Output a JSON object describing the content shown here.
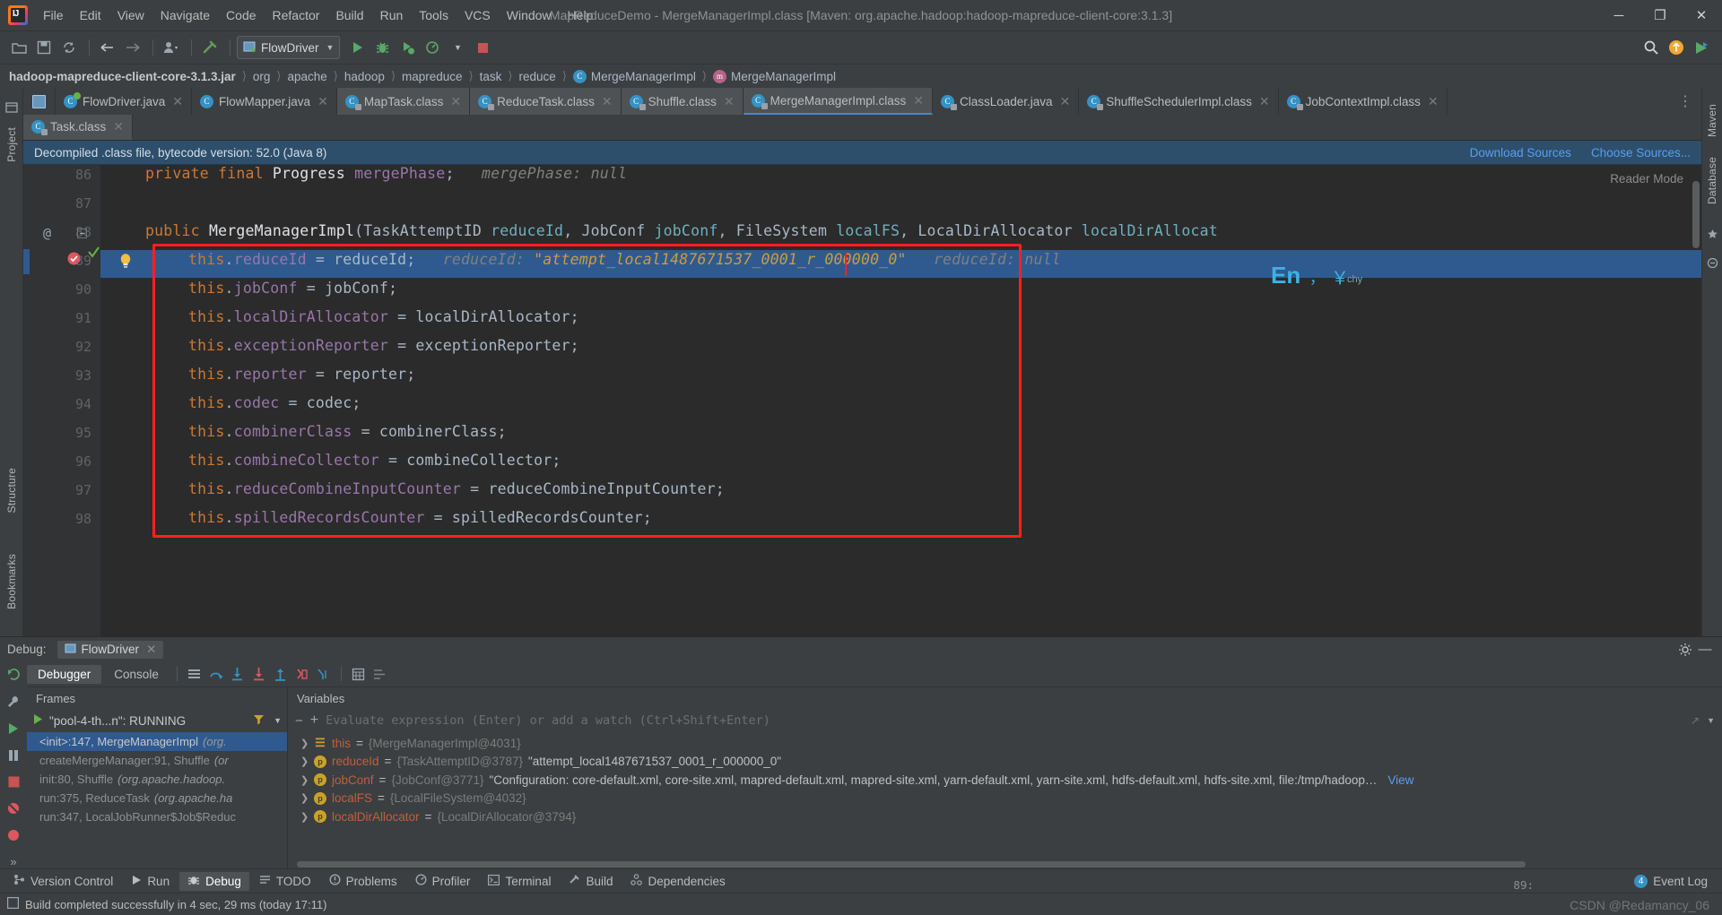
{
  "window": {
    "title": "MapReduceDemo - MergeManagerImpl.class [Maven: org.apache.hadoop:hadoop-mapreduce-client-core:3.1.3]",
    "minimize": "─",
    "maximize": "❐",
    "close": "✕"
  },
  "menu": [
    {
      "label": "File"
    },
    {
      "label": "Edit"
    },
    {
      "label": "View"
    },
    {
      "label": "Navigate"
    },
    {
      "label": "Code"
    },
    {
      "label": "Refactor"
    },
    {
      "label": "Build"
    },
    {
      "label": "Run"
    },
    {
      "label": "Tools"
    },
    {
      "label": "VCS"
    },
    {
      "label": "Window"
    },
    {
      "label": "Help"
    }
  ],
  "toolbar": {
    "run_config": "FlowDriver",
    "icons": [
      "open-folder-icon",
      "save-icon",
      "sync-icon",
      "back-arrow-icon",
      "forward-arrow-icon",
      "profile-user-icon",
      "build-hammer-icon"
    ],
    "run_icon": "run-icon",
    "debug_icon": "debug-icon",
    "run_coverage_icon": "run-with-coverage-icon",
    "profiler_icon": "profiler-icon",
    "stop_icon": "stop-icon",
    "search_icon": "search-icon",
    "update_icon": "update-available-icon",
    "ide_icon": "ide-settings-icon"
  },
  "breadcrumb": [
    {
      "label": "hadoop-mapreduce-client-core-3.1.3.jar",
      "icon": null,
      "bold": true
    },
    {
      "label": "org",
      "icon": null,
      "bold": false
    },
    {
      "label": "apache",
      "icon": null,
      "bold": false
    },
    {
      "label": "hadoop",
      "icon": null,
      "bold": false
    },
    {
      "label": "mapreduce",
      "icon": null,
      "bold": false
    },
    {
      "label": "task",
      "icon": null,
      "bold": false
    },
    {
      "label": "reduce",
      "icon": null,
      "bold": false
    },
    {
      "label": "MergeManagerImpl",
      "icon": "c",
      "bold": false
    },
    {
      "label": "MergeManagerImpl",
      "icon": "m",
      "bold": false
    }
  ],
  "editor_tabs_row1": [
    {
      "label": "FlowDriver.java",
      "icon": "java-class-icon",
      "active": false,
      "closeable": true
    },
    {
      "label": "FlowMapper.java",
      "icon": "java-class-icon",
      "active": false,
      "closeable": true
    },
    {
      "label": "MapTask.class",
      "icon": "decompiled-class-icon",
      "active": false,
      "closeable": true
    },
    {
      "label": "ReduceTask.class",
      "icon": "decompiled-class-icon",
      "active": false,
      "closeable": true
    },
    {
      "label": "Shuffle.class",
      "icon": "decompiled-class-icon",
      "active": false,
      "closeable": true
    },
    {
      "label": "MergeManagerImpl.class",
      "icon": "decompiled-class-icon",
      "active": true,
      "closeable": true
    },
    {
      "label": "ClassLoader.java",
      "icon": "decompiled-class-icon",
      "active": false,
      "closeable": true
    },
    {
      "label": "ShuffleSchedulerImpl.class",
      "icon": "decompiled-class-icon",
      "active": false,
      "closeable": true
    },
    {
      "label": "JobContextImpl.class",
      "icon": "decompiled-class-icon",
      "active": false,
      "closeable": true
    }
  ],
  "editor_tabs_row2": [
    {
      "label": "Task.class",
      "icon": "decompiled-class-icon",
      "active": true,
      "closeable": true
    }
  ],
  "banner": {
    "message": "Decompiled .class file, bytecode version: 52.0 (Java 8)",
    "download_sources": "Download Sources",
    "choose_sources": "Choose Sources..."
  },
  "editor": {
    "reader_mode": "Reader Mode",
    "ime_indicator": "En",
    "ime_punct": "，",
    "ime_yen": "￥",
    "ime_label": "chy",
    "lines": [
      {
        "num": "86",
        "marker": "",
        "segments": [
          {
            "t": "    ",
            "c": "id"
          },
          {
            "t": "private final ",
            "c": "kw"
          },
          {
            "t": "Progress ",
            "c": "white"
          },
          {
            "t": "mergePhase",
            "c": "fld"
          },
          {
            "t": ";",
            "c": "id"
          },
          {
            "t": "   mergePhase: null",
            "c": "inl"
          }
        ]
      },
      {
        "num": "87",
        "marker": "",
        "segments": []
      },
      {
        "num": "88",
        "marker": "@",
        "segments": [
          {
            "t": "    ",
            "c": "id"
          },
          {
            "t": "public ",
            "c": "kw"
          },
          {
            "t": "MergeManagerImpl",
            "c": "white"
          },
          {
            "t": "(TaskAttemptID ",
            "c": "id"
          },
          {
            "t": "reduceId",
            "c": "par"
          },
          {
            "t": ", JobConf ",
            "c": "id"
          },
          {
            "t": "jobConf",
            "c": "par"
          },
          {
            "t": ", FileSystem ",
            "c": "id"
          },
          {
            "t": "localFS",
            "c": "par"
          },
          {
            "t": ", LocalDirAllocator ",
            "c": "id"
          },
          {
            "t": "localDirAllocat",
            "c": "par"
          }
        ]
      },
      {
        "num": "89",
        "marker": "breakpoint",
        "highlight": true,
        "segments": [
          {
            "t": "        ",
            "c": "id"
          },
          {
            "t": "this",
            "c": "kw"
          },
          {
            "t": ".",
            "c": "id"
          },
          {
            "t": "reduceId",
            "c": "fld"
          },
          {
            "t": " = reduceId;",
            "c": "id"
          },
          {
            "t": "   reduceId: ",
            "c": "inl"
          },
          {
            "t": "\"attempt_local1487671537_0001_r_000000_0\"",
            "c": "inlv"
          },
          {
            "t": "   reduceId: null",
            "c": "inl"
          }
        ]
      },
      {
        "num": "90",
        "marker": "",
        "segments": [
          {
            "t": "        ",
            "c": "id"
          },
          {
            "t": "this",
            "c": "kw"
          },
          {
            "t": ".",
            "c": "id"
          },
          {
            "t": "jobConf",
            "c": "fld"
          },
          {
            "t": " = jobConf;",
            "c": "id"
          }
        ]
      },
      {
        "num": "91",
        "marker": "",
        "segments": [
          {
            "t": "        ",
            "c": "id"
          },
          {
            "t": "this",
            "c": "kw"
          },
          {
            "t": ".",
            "c": "id"
          },
          {
            "t": "localDirAllocator",
            "c": "fld"
          },
          {
            "t": " = localDirAllocator;",
            "c": "id"
          }
        ]
      },
      {
        "num": "92",
        "marker": "",
        "segments": [
          {
            "t": "        ",
            "c": "id"
          },
          {
            "t": "this",
            "c": "kw"
          },
          {
            "t": ".",
            "c": "id"
          },
          {
            "t": "exceptionReporter",
            "c": "fld"
          },
          {
            "t": " = exceptionReporter;",
            "c": "id"
          }
        ]
      },
      {
        "num": "93",
        "marker": "",
        "segments": [
          {
            "t": "        ",
            "c": "id"
          },
          {
            "t": "this",
            "c": "kw"
          },
          {
            "t": ".",
            "c": "id"
          },
          {
            "t": "reporter",
            "c": "fld"
          },
          {
            "t": " = reporter;",
            "c": "id"
          }
        ]
      },
      {
        "num": "94",
        "marker": "",
        "segments": [
          {
            "t": "        ",
            "c": "id"
          },
          {
            "t": "this",
            "c": "kw"
          },
          {
            "t": ".",
            "c": "id"
          },
          {
            "t": "codec",
            "c": "fld"
          },
          {
            "t": " = codec;",
            "c": "id"
          }
        ]
      },
      {
        "num": "95",
        "marker": "",
        "segments": [
          {
            "t": "        ",
            "c": "id"
          },
          {
            "t": "this",
            "c": "kw"
          },
          {
            "t": ".",
            "c": "id"
          },
          {
            "t": "combinerClass",
            "c": "fld"
          },
          {
            "t": " = combinerClass;",
            "c": "id"
          }
        ]
      },
      {
        "num": "96",
        "marker": "",
        "segments": [
          {
            "t": "        ",
            "c": "id"
          },
          {
            "t": "this",
            "c": "kw"
          },
          {
            "t": ".",
            "c": "id"
          },
          {
            "t": "combineCollector",
            "c": "fld"
          },
          {
            "t": " = combineCollector;",
            "c": "id"
          }
        ]
      },
      {
        "num": "97",
        "marker": "",
        "segments": [
          {
            "t": "        ",
            "c": "id"
          },
          {
            "t": "this",
            "c": "kw"
          },
          {
            "t": ".",
            "c": "id"
          },
          {
            "t": "reduceCombineInputCounter",
            "c": "fld"
          },
          {
            "t": " = reduceCombineInputCounter;",
            "c": "id"
          }
        ]
      },
      {
        "num": "98",
        "marker": "",
        "segments": [
          {
            "t": "        ",
            "c": "id"
          },
          {
            "t": "this",
            "c": "kw"
          },
          {
            "t": ".",
            "c": "id"
          },
          {
            "t": "spilledRecordsCounter",
            "c": "fld"
          },
          {
            "t": " = spilledRecordsCounter;",
            "c": "id"
          }
        ]
      }
    ]
  },
  "debug": {
    "header_label": "Debug:",
    "session_tab": "FlowDriver",
    "tabs": [
      {
        "label": "Debugger",
        "selected": true
      },
      {
        "label": "Console",
        "selected": false
      }
    ],
    "step_icons": [
      "show-execution-point-icon",
      "step-over-icon",
      "step-into-icon",
      "force-step-into-icon",
      "step-out-icon",
      "drop-frame-icon",
      "run-to-cursor-icon",
      "evaluate-expression-icon",
      "settings-icon"
    ],
    "rail_icons": [
      "rerun-icon",
      "settings-wrench-icon",
      "resume-icon",
      "pause-icon",
      "stop-red-icon",
      "mute-breakpoints-icon",
      "view-breakpoints-icon",
      "expand-icon"
    ],
    "frames_header": "Frames",
    "thread": "\"pool-4-th...n\": RUNNING",
    "frames": [
      {
        "method": "<init>:147, MergeManagerImpl",
        "pkg": "(org.",
        "selected": true
      },
      {
        "method": "createMergeManager:91, Shuffle",
        "pkg": "(or",
        "selected": false
      },
      {
        "method": "init:80, Shuffle",
        "pkg": "(org.apache.hadoop.",
        "selected": false
      },
      {
        "method": "run:375, ReduceTask",
        "pkg": "(org.apache.ha",
        "selected": false
      },
      {
        "method": "run:347, LocalJobRunner$Job$Reduc",
        "pkg": "",
        "selected": false
      }
    ],
    "variables_header": "Variables",
    "eval_placeholder": "Evaluate expression (Enter) or add a watch (Ctrl+Shift+Enter)",
    "variables": [
      {
        "name": "this",
        "icon": "object-icon",
        "value": "{MergeManagerImpl@4031}",
        "string": "",
        "view": false
      },
      {
        "name": "reduceId",
        "icon": "field-icon",
        "value": "{TaskAttemptID@3787}",
        "string": "\"attempt_local1487671537_0001_r_000000_0\"",
        "view": false
      },
      {
        "name": "jobConf",
        "icon": "field-icon",
        "value": "{JobConf@3771}",
        "string": "\"Configuration: core-default.xml, core-site.xml, mapred-default.xml, mapred-site.xml, yarn-default.xml, yarn-site.xml, hdfs-default.xml, hdfs-site.xml, file:/tmp/hadoop…",
        "view": true,
        "view_label": "View"
      },
      {
        "name": "localFS",
        "icon": "field-icon",
        "value": "{LocalFileSystem@4032}",
        "string": "",
        "view": false
      },
      {
        "name": "localDirAllocator",
        "icon": "field-icon",
        "value": "{LocalDirAllocator@3794}",
        "string": "",
        "view": false
      }
    ]
  },
  "left_rail": {
    "label": "Project",
    "bottom_labels": [
      "Structure",
      "Bookmarks"
    ]
  },
  "right_rail": {
    "labels": [
      "Maven",
      "Database"
    ]
  },
  "bottom_bar": [
    {
      "label": "Version Control",
      "icon": "version-control-icon",
      "selected": false
    },
    {
      "label": "Run",
      "icon": "run-icon",
      "selected": false
    },
    {
      "label": "Debug",
      "icon": "debug-icon",
      "selected": true
    },
    {
      "label": "TODO",
      "icon": "todo-icon",
      "selected": false
    },
    {
      "label": "Problems",
      "icon": "problems-icon",
      "selected": false
    },
    {
      "label": "Profiler",
      "icon": "profiler-icon",
      "selected": false
    },
    {
      "label": "Terminal",
      "icon": "terminal-icon",
      "selected": false
    },
    {
      "label": "Build",
      "icon": "build-icon",
      "selected": false
    },
    {
      "label": "Dependencies",
      "icon": "dependencies-icon",
      "selected": false
    }
  ],
  "event_log": {
    "label": "Event Log",
    "count": "4"
  },
  "status": {
    "message": "Build completed successfully in 4 sec, 29 ms (today 17:11)",
    "caret": "89:",
    "watermark": "CSDN @Redamancy_06"
  }
}
